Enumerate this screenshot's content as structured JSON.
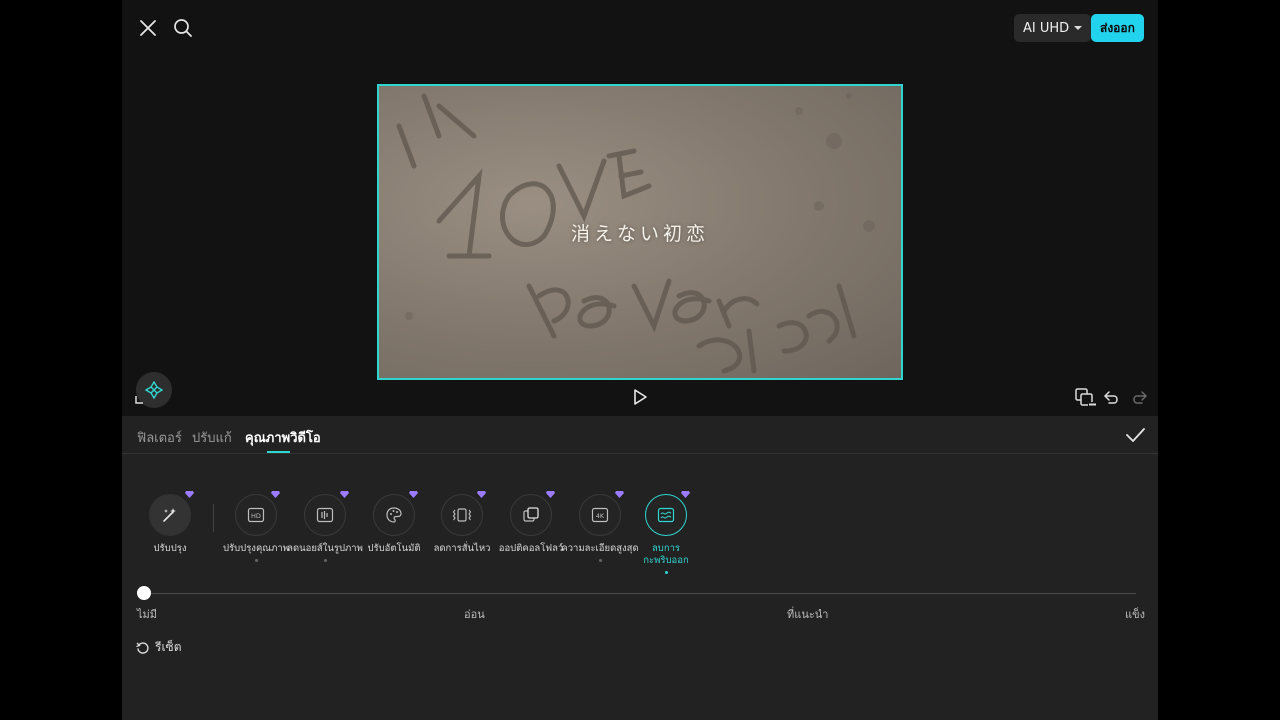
{
  "topbar": {
    "quality_label": "AI UHD",
    "export_label": "ส่งออก"
  },
  "preview": {
    "subtitle": "消えない初恋"
  },
  "tabs": [
    {
      "label": "ฟิลเตอร์"
    },
    {
      "label": "ปรับแก้"
    },
    {
      "label": "คุณภาพวิดีโอ",
      "active": true
    }
  ],
  "tools": [
    {
      "label": "ปรับปรุง",
      "icon": "magic-wand-icon"
    },
    {
      "label": "ปรับปรุงคุณภาพ",
      "icon": "hd-icon"
    },
    {
      "label": "ลดนอยส์ในรูปภาพ",
      "icon": "denoise-icon"
    },
    {
      "label": "ปรับอัตโนมัติ",
      "icon": "palette-icon"
    },
    {
      "label": "ลดการสั่นไหว",
      "icon": "stabilize-icon"
    },
    {
      "label": "ออปติคอลโฟลว์",
      "icon": "optical-flow-icon"
    },
    {
      "label": "ความละเอียดสูงสุด",
      "icon": "4k-icon"
    },
    {
      "label_line1": "ลบการ",
      "label_line2": "กะพริบออก",
      "icon": "deflicker-icon",
      "selected": true
    }
  ],
  "slider": {
    "labels": [
      "ไม่มี",
      "อ่อน",
      "ที่แนะนำ",
      "แข็ง"
    ],
    "value": 0
  },
  "reset_label": "รีเซ็ต",
  "colors": {
    "accent": "#22d3ee",
    "selection": "#2fd6d0",
    "panel": "#222222",
    "background": "#121212"
  }
}
